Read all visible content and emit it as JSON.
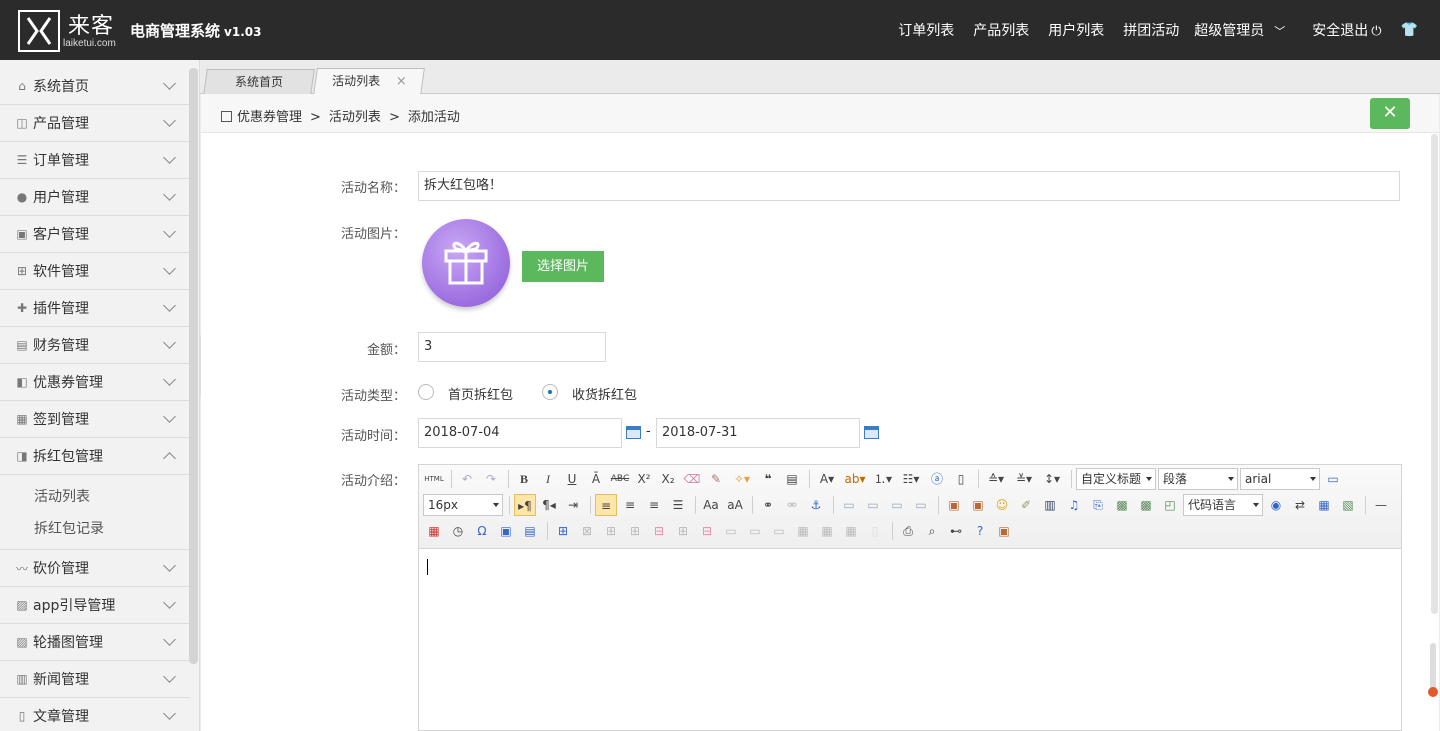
{
  "header": {
    "brand_cn": "来客",
    "brand_en": "laiketui.com",
    "system_title": "电商管理系统",
    "version": "v1.03",
    "nav": [
      "订单列表",
      "产品列表",
      "用户列表",
      "拼团活动"
    ],
    "user": "超级管理员",
    "logout": "安全退出"
  },
  "sidebar": {
    "items": [
      {
        "label": "系统首页",
        "icon": "home-icon"
      },
      {
        "label": "产品管理",
        "icon": "bag-icon"
      },
      {
        "label": "订单管理",
        "icon": "list-icon"
      },
      {
        "label": "用户管理",
        "icon": "user-icon"
      },
      {
        "label": "客户管理",
        "icon": "contact-icon"
      },
      {
        "label": "软件管理",
        "icon": "grid-icon"
      },
      {
        "label": "插件管理",
        "icon": "puzzle-icon"
      },
      {
        "label": "财务管理",
        "icon": "finance-icon"
      },
      {
        "label": "优惠券管理",
        "icon": "coupon-icon"
      },
      {
        "label": "签到管理",
        "icon": "calendar-icon"
      },
      {
        "label": "拆红包管理",
        "icon": "envelope-icon"
      },
      {
        "label": "砍价管理",
        "icon": "trend-icon"
      },
      {
        "label": "app引导管理",
        "icon": "image-icon"
      },
      {
        "label": "轮播图管理",
        "icon": "image-icon"
      },
      {
        "label": "新闻管理",
        "icon": "news-icon"
      },
      {
        "label": "文章管理",
        "icon": "doc-icon"
      }
    ],
    "submenu": [
      "活动列表",
      "拆红包记录"
    ]
  },
  "tabs": [
    {
      "label": "系统首页"
    },
    {
      "label": "活动列表",
      "close": "×"
    }
  ],
  "breadcrumb": [
    "优惠券管理",
    "活动列表",
    "添加活动"
  ],
  "breadcrumb_sep": ">",
  "form": {
    "name_label": "活动名称：",
    "name_value": "拆大红包咯！",
    "image_label": "活动图片：",
    "choose_image": "选择图片",
    "amount_label": "金额：",
    "amount_value": "3",
    "type_label": "活动类型：",
    "type_options": [
      "首页拆红包",
      "收货拆红包"
    ],
    "type_selected": "收货拆红包",
    "time_label": "活动时间：",
    "start_date": "2018-07-04",
    "end_date": "2018-07-31",
    "date_sep": "-",
    "intro_label": "活动介绍："
  },
  "editor": {
    "custom_heading": "自定义标题",
    "paragraph": "段落",
    "font": "arial",
    "font_size": "16px",
    "code_lang": "代码语言",
    "html_btn": "HTML"
  },
  "colors": {
    "header_bg": "#2b2b2b",
    "accent_green": "#5cb85c",
    "gift_purple": "#9c6ee0"
  }
}
